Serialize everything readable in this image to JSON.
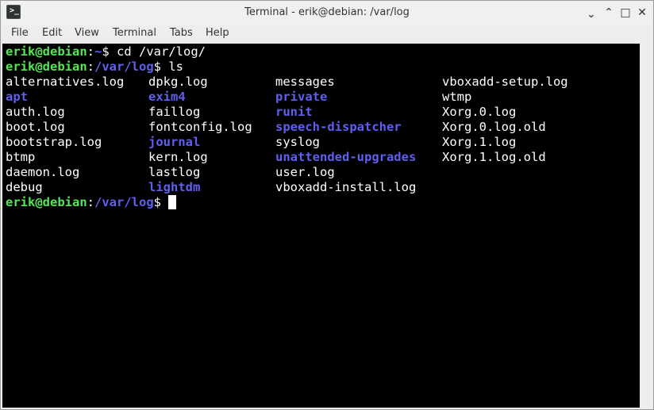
{
  "window": {
    "title": "Terminal - erik@debian: /var/log"
  },
  "window_controls": {
    "minimize": "⌃",
    "restore": "⌃",
    "maximize": "□",
    "close": "✕"
  },
  "menubar": [
    "File",
    "Edit",
    "View",
    "Terminal",
    "Tabs",
    "Help"
  ],
  "prompt": {
    "user_host": "erik@debian",
    "colon": ":",
    "dollar": "$"
  },
  "lines": [
    {
      "cwd": "~",
      "cmd": " cd /var/log/"
    },
    {
      "cwd": "/var/log",
      "cmd": " ls"
    }
  ],
  "ls_columns": [
    [
      {
        "name": "alternatives.log",
        "dir": false
      },
      {
        "name": "apt",
        "dir": true
      },
      {
        "name": "auth.log",
        "dir": false
      },
      {
        "name": "boot.log",
        "dir": false
      },
      {
        "name": "bootstrap.log",
        "dir": false
      },
      {
        "name": "btmp",
        "dir": false
      },
      {
        "name": "daemon.log",
        "dir": false
      },
      {
        "name": "debug",
        "dir": false
      }
    ],
    [
      {
        "name": "dpkg.log",
        "dir": false
      },
      {
        "name": "exim4",
        "dir": true
      },
      {
        "name": "faillog",
        "dir": false
      },
      {
        "name": "fontconfig.log",
        "dir": false
      },
      {
        "name": "journal",
        "dir": true
      },
      {
        "name": "kern.log",
        "dir": false
      },
      {
        "name": "lastlog",
        "dir": false
      },
      {
        "name": "lightdm",
        "dir": true
      }
    ],
    [
      {
        "name": "messages",
        "dir": false
      },
      {
        "name": "private",
        "dir": true
      },
      {
        "name": "runit",
        "dir": true
      },
      {
        "name": "speech-dispatcher",
        "dir": true
      },
      {
        "name": "syslog",
        "dir": false
      },
      {
        "name": "unattended-upgrades",
        "dir": true
      },
      {
        "name": "user.log",
        "dir": false
      },
      {
        "name": "vboxadd-install.log",
        "dir": false
      }
    ],
    [
      {
        "name": "vboxadd-setup.log",
        "dir": false
      },
      {
        "name": "wtmp",
        "dir": false
      },
      {
        "name": "Xorg.0.log",
        "dir": false
      },
      {
        "name": "Xorg.0.log.old",
        "dir": false
      },
      {
        "name": "Xorg.1.log",
        "dir": false
      },
      {
        "name": "Xorg.1.log.old",
        "dir": false
      }
    ]
  ],
  "final_prompt": {
    "cwd": "/var/log"
  },
  "colors": {
    "prompt_user": "#55e855",
    "prompt_path": "#5f5ff0",
    "directory": "#5f5ff0",
    "terminal_bg": "#000000",
    "text": "#ffffff"
  }
}
